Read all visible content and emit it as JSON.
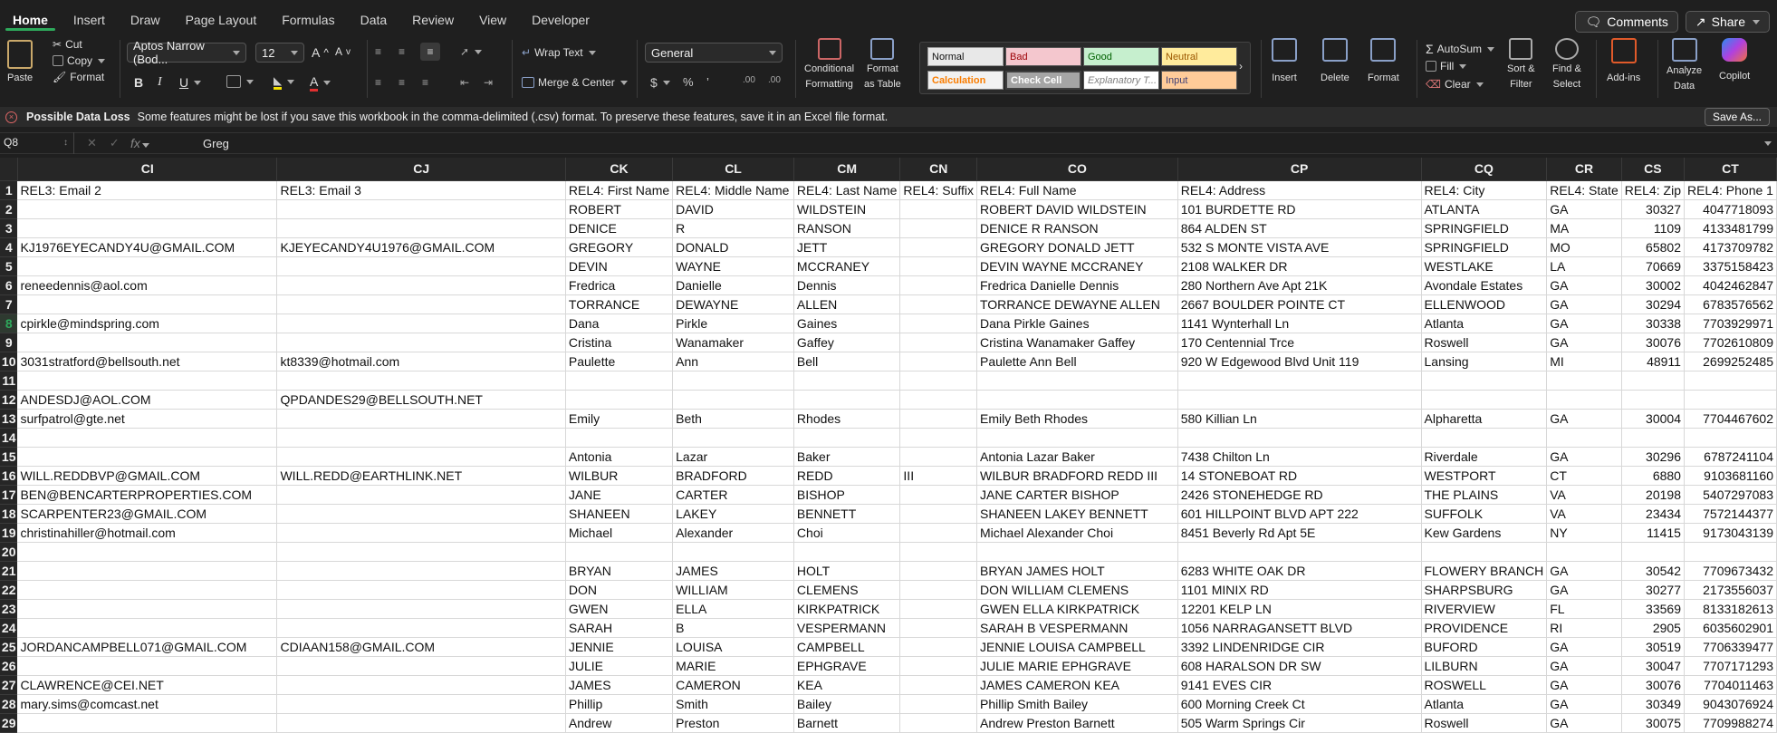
{
  "tabs": [
    "Home",
    "Insert",
    "Draw",
    "Page Layout",
    "Formulas",
    "Data",
    "Review",
    "View",
    "Developer"
  ],
  "top_buttons": {
    "comments": "Comments",
    "share": "Share"
  },
  "ribbon": {
    "paste": "Paste",
    "cut": "Cut",
    "copy": "Copy",
    "format_painter": "Format",
    "font_name": "Aptos Narrow (Bod...",
    "font_size": "12",
    "bold": "B",
    "italic": "I",
    "underline": "U",
    "wrap_text": "Wrap Text",
    "merge_center": "Merge & Center",
    "number_format": "General",
    "currency": "$",
    "percent": "%",
    "cond_format_1": "Conditional",
    "cond_format_2": "Formatting",
    "format_table_1": "Format",
    "format_table_2": "as Table",
    "styles": [
      "Normal",
      "Bad",
      "Good",
      "Neutral",
      "Calculation",
      "Check Cell",
      "Explanatory T...",
      "Input"
    ],
    "insert": "Insert",
    "delete": "Delete",
    "format": "Format",
    "autosum": "AutoSum",
    "fill": "Fill",
    "clear": "Clear",
    "sort_1": "Sort &",
    "sort_2": "Filter",
    "find_1": "Find &",
    "find_2": "Select",
    "addins": "Add-ins",
    "analyze_1": "Analyze",
    "analyze_2": "Data",
    "copilot": "Copilot"
  },
  "message": {
    "title": "Possible Data Loss",
    "text": "Some features might be lost if you save this workbook in the comma-delimited (.csv) format. To preserve these features, save it in an Excel file format.",
    "button": "Save As..."
  },
  "formula_bar": {
    "cell": "Q8",
    "fx": "fx",
    "value": "Greg"
  },
  "columns": [
    "CI",
    "CJ",
    "CK",
    "CL",
    "CM",
    "CN",
    "CO",
    "CP",
    "CQ",
    "CR",
    "CS",
    "CT"
  ],
  "selected_row": 8,
  "rows": [
    [
      "1",
      "REL3: Email 2",
      "REL3: Email 3",
      "REL4: First Name",
      "REL4: Middle Name",
      "REL4: Last Name",
      "REL4: Suffix",
      "REL4: Full Name",
      "REL4: Address",
      "REL4: City",
      "REL4: State",
      "REL4: Zip",
      "REL4: Phone 1"
    ],
    [
      "2",
      "",
      "",
      "ROBERT",
      "DAVID",
      "WILDSTEIN",
      "",
      "ROBERT DAVID WILDSTEIN",
      "101 BURDETTE RD",
      "ATLANTA",
      "GA",
      "30327",
      "4047718093"
    ],
    [
      "3",
      "",
      "",
      "DENICE",
      "R",
      "RANSON",
      "",
      "DENICE R RANSON",
      "864 ALDEN ST",
      "SPRINGFIELD",
      "MA",
      "1109",
      "4133481799"
    ],
    [
      "4",
      "KJ1976EYECANDY4U@GMAIL.COM",
      "KJEYECANDY4U1976@GMAIL.COM",
      "GREGORY",
      "DONALD",
      "JETT",
      "",
      "GREGORY DONALD JETT",
      "532 S MONTE VISTA AVE",
      "SPRINGFIELD",
      "MO",
      "65802",
      "4173709782"
    ],
    [
      "5",
      "",
      "",
      "DEVIN",
      "WAYNE",
      "MCCRANEY",
      "",
      "DEVIN WAYNE MCCRANEY",
      "2108 WALKER DR",
      "WESTLAKE",
      "LA",
      "70669",
      "3375158423"
    ],
    [
      "6",
      "reneedennis@aol.com",
      "",
      "Fredrica",
      "Danielle",
      "Dennis",
      "",
      "Fredrica Danielle Dennis",
      "280 Northern Ave Apt 21K",
      "Avondale Estates",
      "GA",
      "30002",
      "4042462847"
    ],
    [
      "7",
      "",
      "",
      "TORRANCE",
      "DEWAYNE",
      "ALLEN",
      "",
      "TORRANCE DEWAYNE ALLEN",
      "2667 BOULDER POINTE CT",
      "ELLENWOOD",
      "GA",
      "30294",
      "6783576562"
    ],
    [
      "8",
      "cpirkle@mindspring.com",
      "",
      "Dana",
      "Pirkle",
      "Gaines",
      "",
      "Dana Pirkle Gaines",
      "1141 Wynterhall Ln",
      "Atlanta",
      "GA",
      "30338",
      "7703929971"
    ],
    [
      "9",
      "",
      "",
      "Cristina",
      "Wanamaker",
      "Gaffey",
      "",
      "Cristina Wanamaker Gaffey",
      "170 Centennial Trce",
      "Roswell",
      "GA",
      "30076",
      "7702610809"
    ],
    [
      "10",
      "3031stratford@bellsouth.net",
      "kt8339@hotmail.com",
      "Paulette",
      "Ann",
      "Bell",
      "",
      "Paulette Ann Bell",
      "920 W Edgewood Blvd Unit 119",
      "Lansing",
      "MI",
      "48911",
      "2699252485"
    ],
    [
      "11",
      "",
      "",
      "",
      "",
      "",
      "",
      "",
      "",
      "",
      "",
      "",
      ""
    ],
    [
      "12",
      "ANDESDJ@AOL.COM",
      "QPDANDES29@BELLSOUTH.NET",
      "",
      "",
      "",
      "",
      "",
      "",
      "",
      "",
      "",
      ""
    ],
    [
      "13",
      "surfpatrol@gte.net",
      "",
      "Emily",
      "Beth",
      "Rhodes",
      "",
      "Emily Beth Rhodes",
      "580 Killian Ln",
      "Alpharetta",
      "GA",
      "30004",
      "7704467602"
    ],
    [
      "14",
      "",
      "",
      "",
      "",
      "",
      "",
      "",
      "",
      "",
      "",
      "",
      ""
    ],
    [
      "15",
      "",
      "",
      "Antonia",
      "Lazar",
      "Baker",
      "",
      "Antonia Lazar Baker",
      "7438 Chilton Ln",
      "Riverdale",
      "GA",
      "30296",
      "6787241104"
    ],
    [
      "16",
      "WILL.REDDBVP@GMAIL.COM",
      "WILL.REDD@EARTHLINK.NET",
      "WILBUR",
      "BRADFORD",
      "REDD",
      "III",
      "WILBUR BRADFORD REDD III",
      "14 STONEBOAT RD",
      "WESTPORT",
      "CT",
      "6880",
      "9103681160"
    ],
    [
      "17",
      "BEN@BENCARTERPROPERTIES.COM",
      "",
      "JANE",
      "CARTER",
      "BISHOP",
      "",
      "JANE CARTER BISHOP",
      "2426 STONEHEDGE RD",
      "THE PLAINS",
      "VA",
      "20198",
      "5407297083"
    ],
    [
      "18",
      "SCARPENTER23@GMAIL.COM",
      "",
      "SHANEEN",
      "LAKEY",
      "BENNETT",
      "",
      "SHANEEN LAKEY BENNETT",
      "601 HILLPOINT BLVD APT 222",
      "SUFFOLK",
      "VA",
      "23434",
      "7572144377"
    ],
    [
      "19",
      "christinahiller@hotmail.com",
      "",
      "Michael",
      "Alexander",
      "Choi",
      "",
      "Michael Alexander Choi",
      "8451 Beverly Rd Apt 5E",
      "Kew Gardens",
      "NY",
      "11415",
      "9173043139"
    ],
    [
      "20",
      "",
      "",
      "",
      "",
      "",
      "",
      "",
      "",
      "",
      "",
      "",
      ""
    ],
    [
      "21",
      "",
      "",
      "BRYAN",
      "JAMES",
      "HOLT",
      "",
      "BRYAN JAMES HOLT",
      "6283 WHITE OAK DR",
      "FLOWERY BRANCH",
      "GA",
      "30542",
      "7709673432"
    ],
    [
      "22",
      "",
      "",
      "DON",
      "WILLIAM",
      "CLEMENS",
      "",
      "DON WILLIAM CLEMENS",
      "1101 MINIX RD",
      "SHARPSBURG",
      "GA",
      "30277",
      "2173556037"
    ],
    [
      "23",
      "",
      "",
      "GWEN",
      "ELLA",
      "KIRKPATRICK",
      "",
      "GWEN ELLA KIRKPATRICK",
      "12201 KELP LN",
      "RIVERVIEW",
      "FL",
      "33569",
      "8133182613"
    ],
    [
      "24",
      "",
      "",
      "SARAH",
      "B",
      "VESPERMANN",
      "",
      "SARAH B VESPERMANN",
      "1056 NARRAGANSETT BLVD",
      "PROVIDENCE",
      "RI",
      "2905",
      "6035602901"
    ],
    [
      "25",
      "JORDANCAMPBELL071@GMAIL.COM",
      "CDIAAN158@GMAIL.COM",
      "JENNIE",
      "LOUISA",
      "CAMPBELL",
      "",
      "JENNIE LOUISA CAMPBELL",
      "3392 LINDENRIDGE CIR",
      "BUFORD",
      "GA",
      "30519",
      "7706339477"
    ],
    [
      "26",
      "",
      "",
      "JULIE",
      "MARIE",
      "EPHGRAVE",
      "",
      "JULIE MARIE EPHGRAVE",
      "608 HARALSON DR SW",
      "LILBURN",
      "GA",
      "30047",
      "7707171293"
    ],
    [
      "27",
      "CLAWRENCE@CEI.NET",
      "",
      "JAMES",
      "CAMERON",
      "KEA",
      "",
      "JAMES CAMERON KEA",
      "9141 EVES CIR",
      "ROSWELL",
      "GA",
      "30076",
      "7704011463"
    ],
    [
      "28",
      "mary.sims@comcast.net",
      "",
      "Phillip",
      "Smith",
      "Bailey",
      "",
      "Phillip Smith Bailey",
      "600 Morning Creek Ct",
      "Atlanta",
      "GA",
      "30349",
      "9043076924"
    ],
    [
      "29",
      "",
      "",
      "Andrew",
      "Preston",
      "Barnett",
      "",
      "Andrew Preston Barnett",
      "505 Warm Springs Cir",
      "Roswell",
      "GA",
      "30075",
      "7709988274"
    ]
  ]
}
